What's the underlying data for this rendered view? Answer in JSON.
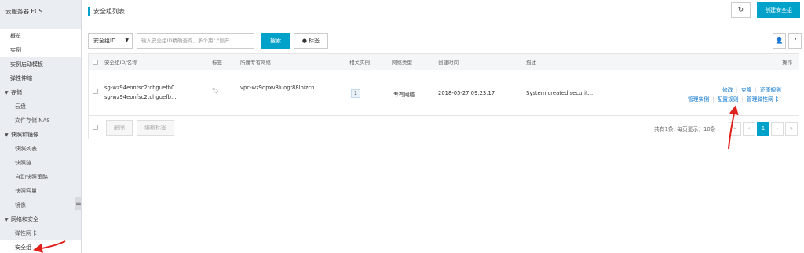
{
  "sidebar": {
    "title": "云服务器 ECS",
    "items": [
      {
        "label": "概览",
        "kind": "item"
      },
      {
        "label": "实例",
        "kind": "item"
      },
      {
        "label": "实例启动模板",
        "kind": "item"
      },
      {
        "label": "弹性伸缩",
        "kind": "item"
      },
      {
        "label": "存储",
        "kind": "group"
      },
      {
        "label": "云盘",
        "kind": "sub"
      },
      {
        "label": "文件存储 NAS",
        "kind": "sub"
      },
      {
        "label": "快照和镜像",
        "kind": "group"
      },
      {
        "label": "快照列表",
        "kind": "sub"
      },
      {
        "label": "快照链",
        "kind": "sub"
      },
      {
        "label": "自动快照策略",
        "kind": "sub"
      },
      {
        "label": "快照容量",
        "kind": "sub"
      },
      {
        "label": "镜像",
        "kind": "sub"
      },
      {
        "label": "网络和安全",
        "kind": "group"
      },
      {
        "label": "弹性网卡",
        "kind": "sub"
      },
      {
        "label": "安全组",
        "kind": "sub"
      }
    ],
    "collapse_glyph": "☰"
  },
  "header": {
    "title": "安全组列表",
    "refresh_glyph": "↻",
    "create_label": "创建安全组"
  },
  "filter": {
    "select_value": "安全组ID",
    "search_placeholder": "输入安全组ID精确查询，多个用\",\"隔开",
    "search_label": "搜索",
    "tag_label": "标签",
    "user_glyph": "👤",
    "help_glyph": "?"
  },
  "table": {
    "headers": {
      "id_name": "安全组ID/名称",
      "tag": "标签",
      "vpc": "所属专有网络",
      "instances": "相关实例",
      "network_type": "网络类型",
      "created": "创建时间",
      "description": "描述",
      "actions": "操作"
    },
    "row": {
      "id": "sg-wz94eonfsc2tchguefb0",
      "name": "sg-wz94eonfsc2tchguefb...",
      "tag_glyph": "🏷",
      "vpc": "vpc-wz9qpxv8luogf88lnizcn",
      "instances": "1",
      "network_type": "专有网络",
      "created": "2018-05-27 09:23:17",
      "description": "System created securit...",
      "actions": {
        "modify": "修改",
        "clone": "克隆",
        "restore": "还原规则",
        "manage_instances": "管理实例",
        "configure_rules": "配置规则",
        "manage_eni": "管理弹性网卡"
      }
    },
    "footer": {
      "delete_label": "删除",
      "edit_tags_label": "编辑标签",
      "summary": "共有1条, 每页显示：10条",
      "first": "«",
      "prev": "‹",
      "current_page": "1",
      "next": "›",
      "last": "»"
    }
  },
  "colors": {
    "accent": "#00a2ca",
    "link": "#0070cc",
    "annotation_arrow": "#e0201b"
  }
}
